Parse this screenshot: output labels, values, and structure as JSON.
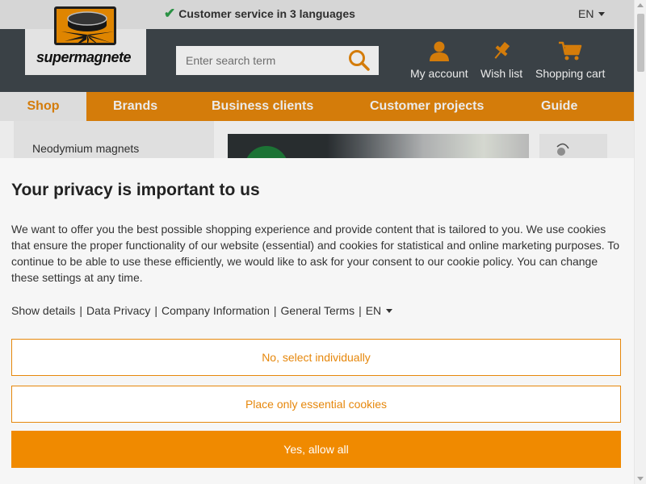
{
  "topbar": {
    "service_text": "Customer service in 3 languages",
    "language": "EN"
  },
  "header": {
    "logo_text": "supermagnete",
    "search": {
      "placeholder": "Enter search term"
    },
    "nav": [
      {
        "label": "My account",
        "icon": "user-icon"
      },
      {
        "label": "Wish list",
        "icon": "pin-icon"
      },
      {
        "label": "Shopping cart",
        "icon": "cart-icon"
      }
    ]
  },
  "main_nav": {
    "tabs": [
      {
        "label": "Shop",
        "active": true
      },
      {
        "label": "Brands"
      },
      {
        "label": "Business clients"
      },
      {
        "label": "Customer projects"
      },
      {
        "label": "Guide"
      }
    ]
  },
  "sidebar": {
    "items": [
      {
        "label": "Neodymium magnets"
      }
    ]
  },
  "cookie_dialog": {
    "title": "Your privacy is important to us",
    "description": "We want to offer you the best possible shopping experience and provide content that is tailored to you. We use cookies that ensure the proper functionality of our website (essential) and cookies for statistical and online marketing purposes. To continue to be able to use these efficiently, we would like to ask for your consent to our cookie policy. You can change these settings at any time.",
    "links": [
      {
        "label": "Show details"
      },
      {
        "label": "Data Privacy"
      },
      {
        "label": "Company Information"
      },
      {
        "label": "General Terms"
      },
      {
        "label": "EN"
      }
    ],
    "buttons": {
      "select_individually": "No, select individually",
      "essential_only": "Place only essential cookies",
      "allow_all": "Yes, allow all"
    }
  },
  "colors": {
    "accent": "#e6870b",
    "header_bg": "#3f474d",
    "dialog_bg": "#f6f6f6"
  }
}
